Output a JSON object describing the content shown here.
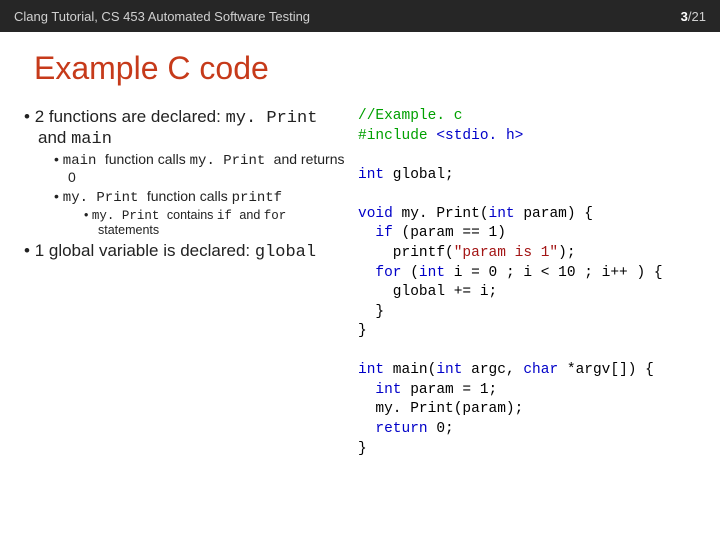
{
  "header": {
    "left": "Clang Tutorial, CS 453 Automated Software Testing",
    "page_current": "3",
    "page_sep": "/",
    "page_total": "21"
  },
  "title": "Example C code",
  "bul": {
    "l1a": "2 functions are declared: ",
    "l1a_code": "my. Print ",
    "l1a_mid": "and ",
    "l1a_code2": "main",
    "l2a_code": "main ",
    "l2a_txt": " function calls ",
    "l2a_code2": "my. Print ",
    "l2a_txt2": "and returns 0",
    "l2b_code": "my. Print ",
    "l2b_txt": "function calls ",
    "l2b_code2": "printf",
    "l3a_code": "my. Print ",
    "l3a_txt": "contains ",
    "l3a_code2": "if ",
    "l3a_txt2": "and ",
    "l3a_code3": "for ",
    "l3a_txt3": "statements",
    "l1b": "1 global variable is declared: ",
    "l1b_code": "global"
  },
  "code": {
    "c01a": "//Example. c",
    "c02a": "#include ",
    "c02b": "<stdio. h>",
    "c04a": "int",
    "c04b": " global;",
    "c06a": "void",
    "c06b": " my. Print(",
    "c06c": "int",
    "c06d": " param) {",
    "c07a": "  if",
    "c07b": " (param == 1)",
    "c08a": "    printf(",
    "c08b": "\"param is 1\"",
    "c08c": ");",
    "c09a": "  for",
    "c09b": " (",
    "c09c": "int",
    "c09d": " i = 0 ; i < 10 ; i++ ) {",
    "c10": "    global += i;",
    "c11": "  }",
    "c12": "}",
    "c14a": "int",
    "c14b": " main(",
    "c14c": "int",
    "c14d": " argc, ",
    "c14e": "char",
    "c14f": " *argv[]) {",
    "c15a": "  int",
    "c15b": " param = 1;",
    "c16": "  my. Print(param);",
    "c17a": "  return",
    "c17b": " 0;",
    "c18": "}"
  }
}
